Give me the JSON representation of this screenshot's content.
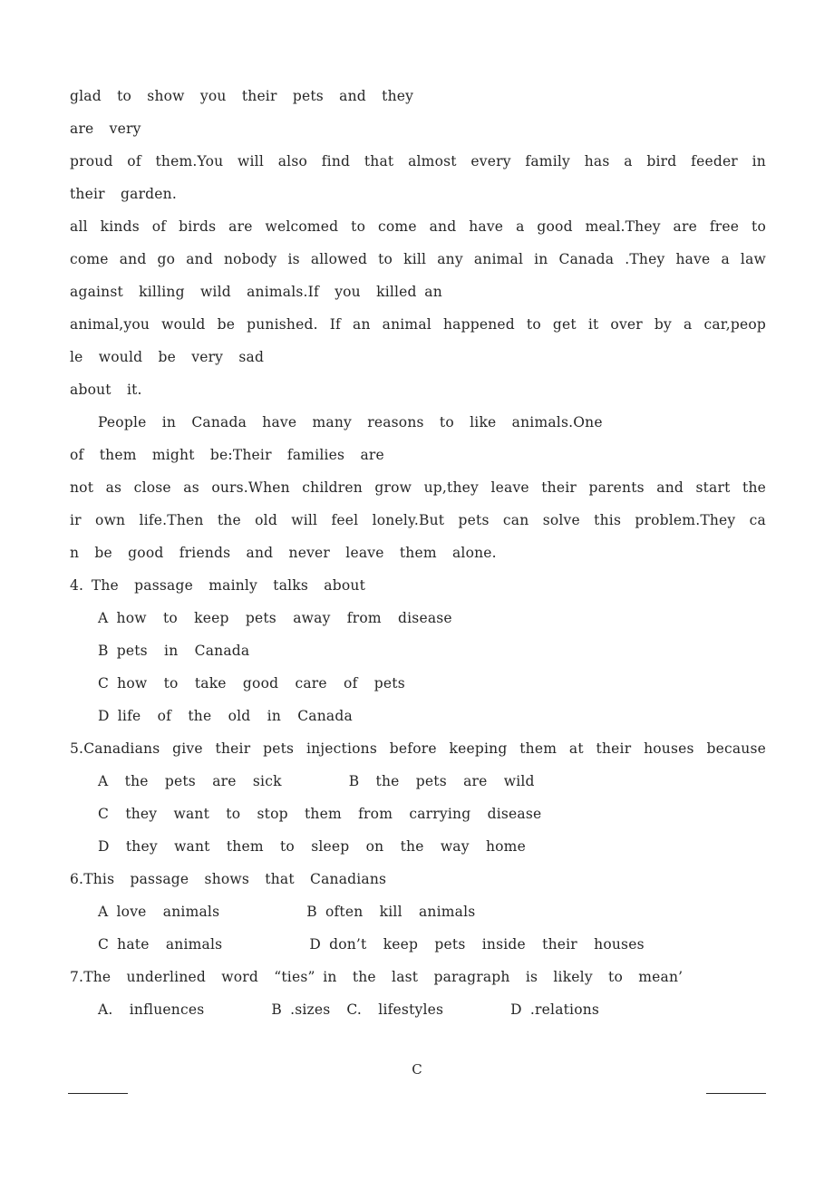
{
  "document": {
    "type": "scanned-exam-page",
    "page_mark": "C",
    "passage_lines": [
      {
        "id": "p1l1",
        "text": "glad  to  show  you  their  pets  and  they",
        "style": "ragged"
      },
      {
        "id": "p1l2",
        "text": "are  very",
        "style": "ragged"
      },
      {
        "id": "p1l3",
        "text": "proud of them.You will also find that almost every family has a bird feeder in",
        "style": "justify"
      },
      {
        "id": "p1l4",
        "text": "their  garden.",
        "style": "ragged"
      },
      {
        "id": "p1l5",
        "text": "all kinds of birds are welcomed to come and have a good meal.They are free to",
        "style": "justify"
      },
      {
        "id": "p1l6",
        "text": "come and go and nobody is allowed to kill any animal in Canada .They have a law",
        "style": "justify"
      },
      {
        "id": "p1l7",
        "text": "against  killing  wild  animals.If  you  killed an",
        "style": "ragged"
      },
      {
        "id": "p1l8",
        "text": "animal,you would be punished.  If an animal happened to get it over by a car,peop",
        "style": "justify"
      },
      {
        "id": "p1l9",
        "text": "le  would  be  very  sad",
        "style": "ragged"
      },
      {
        "id": "p1l10",
        "text": "about  it.",
        "style": "ragged"
      },
      {
        "id": "p2l1",
        "text": "People  in  Canada  have  many  reasons  to  like  animals.One",
        "style": "ragged-indent"
      },
      {
        "id": "p2l2",
        "text": "of  them  might  be:Their  families  are",
        "style": "ragged"
      },
      {
        "id": "p2l3",
        "text": "not as close as ours.When children grow up,they leave their parents and start the",
        "style": "justify"
      },
      {
        "id": "p2l4",
        "text": "ir own life.Then the old will feel lonely.But pets can solve this problem.They ca",
        "style": "justify"
      },
      {
        "id": "p2l5",
        "text": "n  be  good  friends  and  never  leave  them  alone.",
        "style": "ragged"
      }
    ],
    "questions": [
      {
        "id": "q4",
        "stem": "4. The  passage  mainly  talks  about",
        "option_lines": [
          {
            "text": "A how  to  keep  pets  away  from  disease"
          },
          {
            "text": "B pets  in  Canada"
          },
          {
            "text": "C how  to  take  good  care  of  pets"
          },
          {
            "text": "D life  of  the  old  in  Canada"
          }
        ]
      },
      {
        "id": "q5",
        "stem": "5.Canadians  give  their  pets  injections  before  keeping  them  at their  houses  because",
        "stem_style": "justify",
        "option_lines": [
          {
            "text": "A  the  pets  are  sick",
            "text_b": "B  the  pets  are  wild",
            "two_col": true
          },
          {
            "text": "C  they  want  to  stop  them  from  carrying  disease"
          },
          {
            "text": "D  they  want  them  to  sleep  on  the  way  home"
          }
        ]
      },
      {
        "id": "q6",
        "stem": "6.This  passage  shows  that  Canadians",
        "option_lines": [
          {
            "text": "A love  animals",
            "text_b": "B often  kill  animals",
            "two_col": true
          },
          {
            "text": "C hate  animals",
            "text_b": "D don’t  keep  pets  inside  their  houses",
            "two_col": true
          }
        ]
      },
      {
        "id": "q7",
        "stem": "7.The  underlined  word  “ties” in  the  last  paragraph  is  likely  to  mean’",
        "option_lines": [
          {
            "text": "A.  influences",
            "text_b": "B .sizes",
            "text_c": "C.  lifestyles",
            "text_d": "D .relations",
            "four_col": true
          }
        ]
      }
    ],
    "footer": {
      "center_mark": "C",
      "rule_left": "",
      "rule_right": ""
    }
  },
  "colors": {
    "page_background": "#ffffff",
    "text": "#262626",
    "rule": "#262626"
  }
}
